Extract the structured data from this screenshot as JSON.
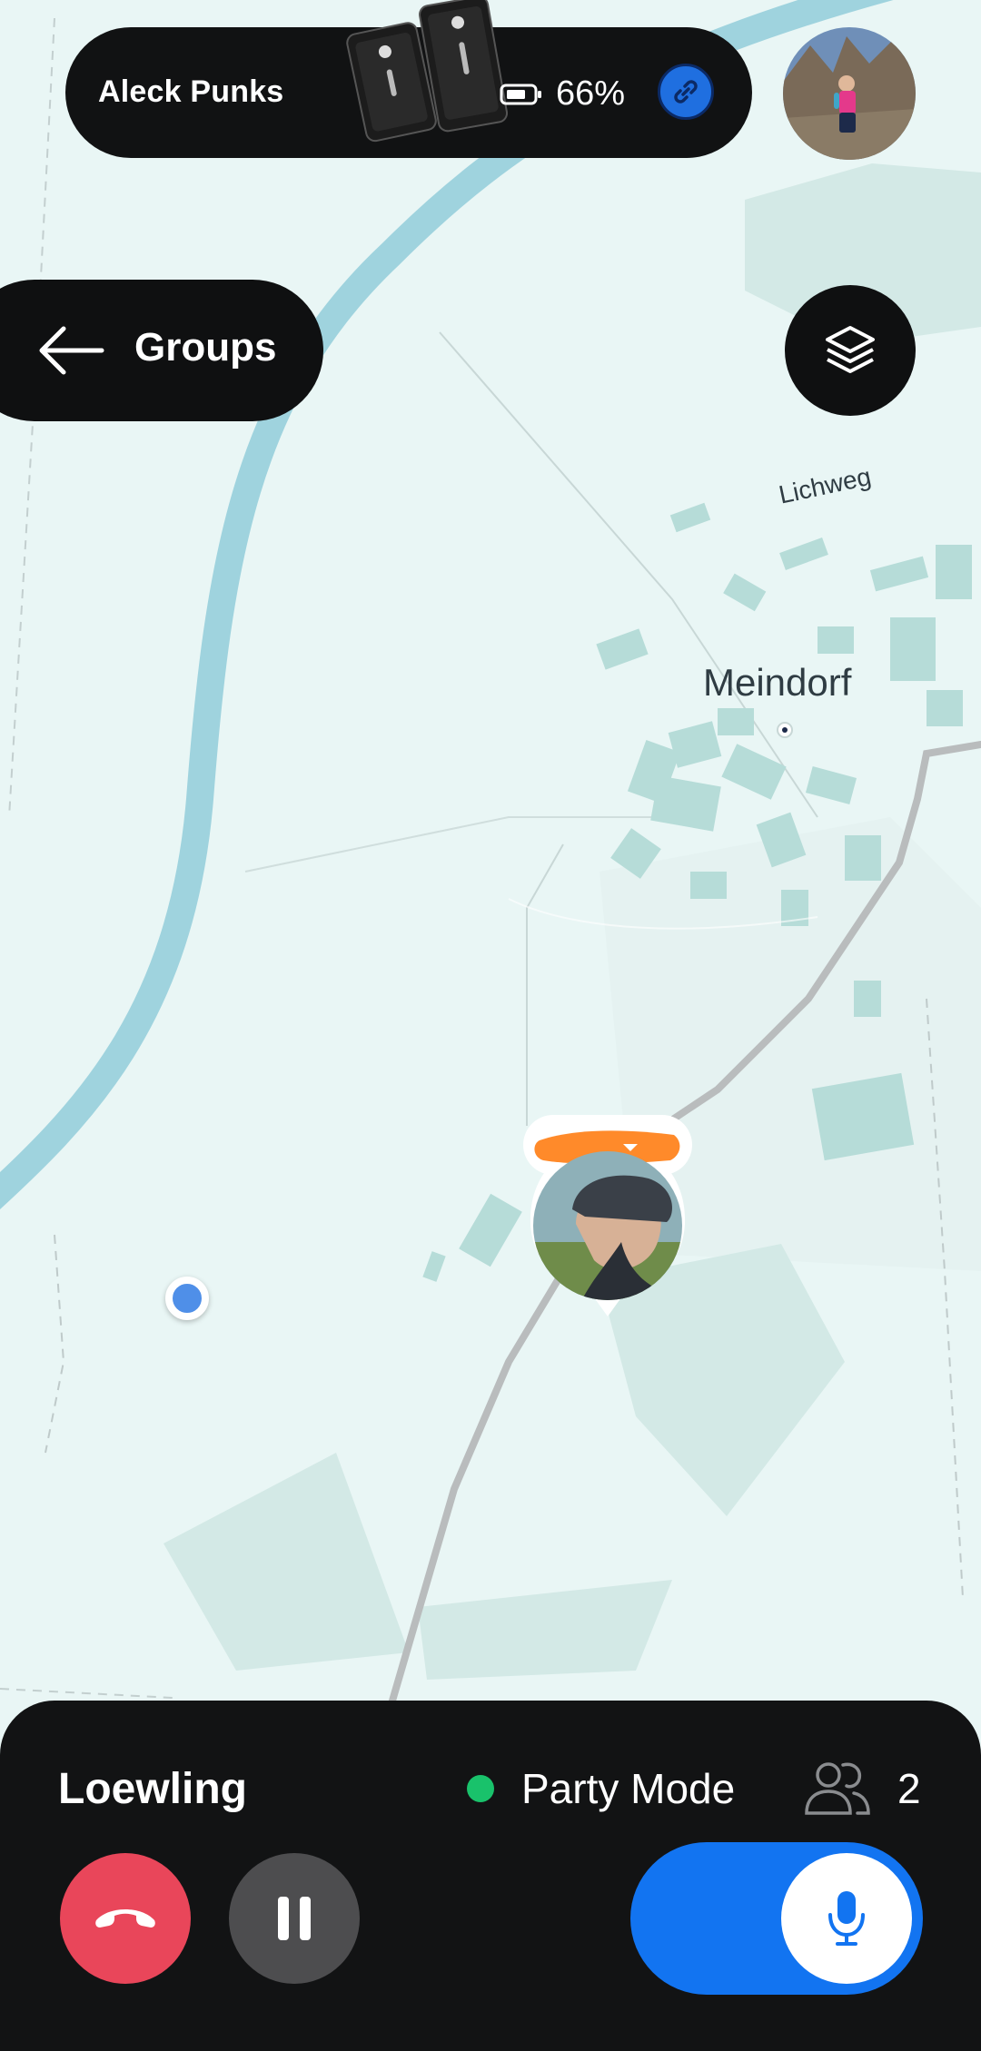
{
  "header": {
    "device_name": "Aleck Punks",
    "battery_level": "66%",
    "battery_icon": "battery-icon",
    "link_icon": "link-icon",
    "avatar": "user-avatar"
  },
  "nav": {
    "back_icon": "arrow-left-icon",
    "groups_label": "Groups",
    "layers_icon": "layers-icon"
  },
  "map": {
    "place_label": "Meindorf",
    "street_label": "Lichweg",
    "colors": {
      "background": "#e9f6f5",
      "river": "#9fd3de",
      "buildings": "#b6dcd8",
      "road": "#b9bcbd"
    }
  },
  "bottom_bar": {
    "group_name": "Loewling",
    "mode_label": "Party Mode",
    "mode_status_color": "#19c26b",
    "participants_icon": "people-icon",
    "participants_count": "2",
    "hangup_icon": "phone-hangup-icon",
    "pause_icon": "pause-icon",
    "mic_icon": "microphone-icon",
    "mic_toggle_on": true,
    "accent_color": "#1274f1",
    "hangup_color": "#e9465a"
  }
}
